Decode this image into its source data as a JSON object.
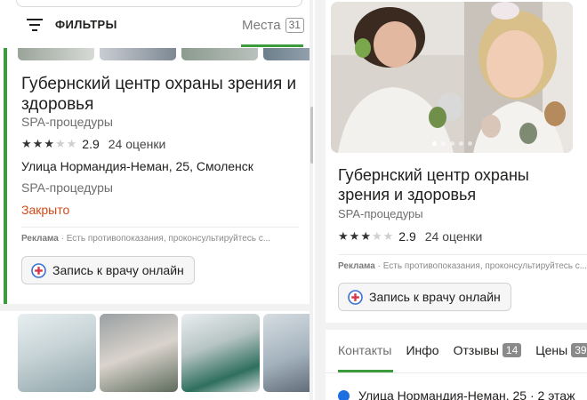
{
  "filters": {
    "label": "ФИЛЬТРЫ",
    "icon": "filter-icon"
  },
  "places_tab": {
    "label": "Места",
    "count": "31"
  },
  "listing": {
    "title": "Губернский центр охраны зрения и здоровья",
    "category": "SPA-процедуры",
    "rating": 2.9,
    "rating_text": "2.9",
    "reviews": "24 оценки",
    "address": "Улица Нормандия-Неман, 25, Смоленск",
    "category2": "SPA-процедуры",
    "status": "Закрыто",
    "ad_label": "Реклама",
    "ad_text": "Есть противопоказания, проконсультируйтесь с...",
    "book_label": "Запись к врачу онлайн"
  },
  "detail": {
    "title": "Губернский центр охраны зрения и здоровья",
    "category": "SPA-процедуры",
    "rating_text": "2.9",
    "reviews": "24 оценки",
    "ad_label": "Реклама",
    "ad_text": "Есть противопоказания, проконсультируйтесь с...",
    "book_label": "Запись к врачу онлайн",
    "tabs": [
      {
        "label": "Контакты"
      },
      {
        "label": "Инфо"
      },
      {
        "label": "Отзывы",
        "badge": "14"
      },
      {
        "label": "Цены",
        "badge": "39"
      }
    ],
    "address_line": "Улица Нормандия-Неман, 25 · 2 этаж"
  },
  "colors": {
    "accent_green": "#3c9b3c",
    "closed_orange": "#d34a18",
    "location_blue": "#1b6fe0"
  }
}
